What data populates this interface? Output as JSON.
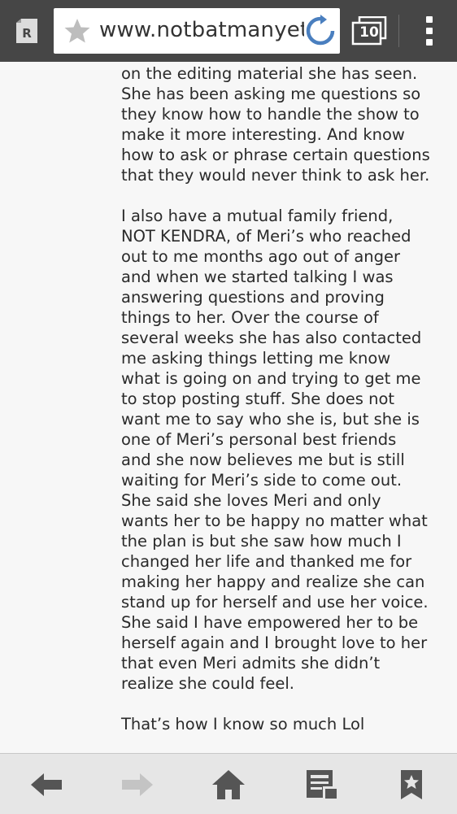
{
  "toolbar": {
    "reader_label": "R",
    "url": "www.notbatmanyet",
    "tab_count": "10"
  },
  "article": {
    "paragraphs": [
      "on the editing material she has seen. She has been asking me questions so they know how to handle the show to make it more interesting. And know how to ask or phrase certain questions that they would never think to ask her.",
      "I also have a mutual family friend, NOT KENDRA, of Meri’s who reached out to me months ago out of anger and when we started talking I was answering questions and proving things to her. Over the course of several weeks she has also contacted me asking things letting me know what is going on and trying to get me to stop posting stuff. She does not want me to say who she is, but she is one of Meri’s personal best friends and she now believes me but is still waiting for Meri’s side to come out. She said she loves Meri and only wants her to be happy no matter what the plan is but she saw how much I changed her life and thanked me for making her happy and realize she can stand up for herself and use her voice. She said I have empowered her to be herself again and I brought love to her that even Meri admits she didn’t realize she could feel.",
      "That’s how I know so much Lol"
    ]
  },
  "bottom_nav": {
    "back_icon": "back-arrow-icon",
    "forward_icon": "forward-arrow-icon",
    "home_icon": "home-icon",
    "reading_list_icon": "reading-list-icon",
    "bookmark_icon": "bookmark-icon"
  },
  "colors": {
    "toolbar_bg": "#464646",
    "page_bg": "#f7f7f7",
    "bottom_bg": "#e6e6e6",
    "reload_blue": "#4a7fbf",
    "nav_icon": "#555555",
    "nav_icon_disabled": "#c4c4c4"
  }
}
